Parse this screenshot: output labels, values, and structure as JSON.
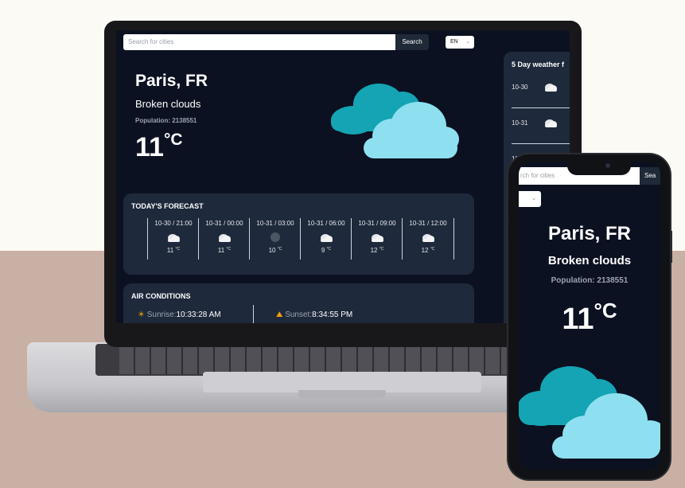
{
  "search": {
    "placeholder": "Search for cities",
    "button": "Search",
    "phone_placeholder": "rch for cities",
    "phone_button": "Sea"
  },
  "language": {
    "selected": "EN"
  },
  "current": {
    "city": "Paris, FR",
    "description": "Broken clouds",
    "population_label": "Population: 2138551",
    "temp": "11",
    "unit": "°C"
  },
  "todays_forecast": {
    "title": "TODAY'S FORECAST",
    "items": [
      {
        "time": "10-30 / 21:00",
        "temp": "11",
        "unit": "°C",
        "icon": "broken-clouds-icon"
      },
      {
        "time": "10-31 / 00:00",
        "temp": "11",
        "unit": "°C",
        "icon": "broken-clouds-icon"
      },
      {
        "time": "10-31 / 03:00",
        "temp": "10",
        "unit": "°C",
        "icon": "overcast-icon"
      },
      {
        "time": "10-31 / 06:00",
        "temp": "9",
        "unit": "°C",
        "icon": "broken-clouds-icon"
      },
      {
        "time": "10-31 / 09:00",
        "temp": "12",
        "unit": "°C",
        "icon": "broken-clouds-icon"
      },
      {
        "time": "10-31 / 12:00",
        "temp": "12",
        "unit": "°C",
        "icon": "broken-clouds-icon"
      }
    ]
  },
  "air_conditions": {
    "title": "AIR CONDITIONS",
    "sunrise_label": "Sunrise:",
    "sunrise_value": "10:33:28 AM",
    "sunset_label": "Sunset:",
    "sunset_value": "8:34:55 PM"
  },
  "five_day": {
    "title": "5 Day weather f",
    "days": [
      {
        "date": "10-30"
      },
      {
        "date": "10-31"
      },
      {
        "date": "11-"
      }
    ]
  }
}
